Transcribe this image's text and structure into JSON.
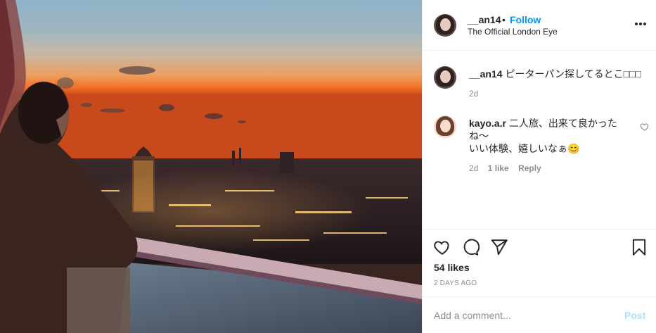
{
  "post": {
    "image_alt": "Sunset view over London from a London Eye capsule",
    "header": {
      "username": "__an14",
      "separator": "•",
      "follow_label": "Follow",
      "location": "The Official London Eye",
      "more_icon": "more-horizontal-icon"
    },
    "caption": {
      "username": "__an14",
      "text": "ピーターパン探してるとこ□□□",
      "time": "2d"
    },
    "comments": [
      {
        "username": "kayo.a.r",
        "text_line1": "二人旅、出来て良かったね〜",
        "text_line2": "いい体験、嬉しいなぁ😊",
        "time": "2d",
        "likes": "1 like",
        "reply_label": "Reply",
        "like_icon": "heart-outline-icon"
      }
    ],
    "actions": {
      "like_icon": "heart-outline-icon",
      "comment_icon": "comment-icon",
      "share_icon": "paper-plane-icon",
      "save_icon": "bookmark-icon"
    },
    "likes_label": "54 likes",
    "date_label": "2 DAYS AGO",
    "add_comment": {
      "placeholder": "Add a comment...",
      "post_label": "Post"
    },
    "colors": {
      "link_blue": "#0095f6",
      "post_disabled": "#b2dffc",
      "muted_text": "#8e8e8e",
      "border": "#efefef"
    }
  }
}
